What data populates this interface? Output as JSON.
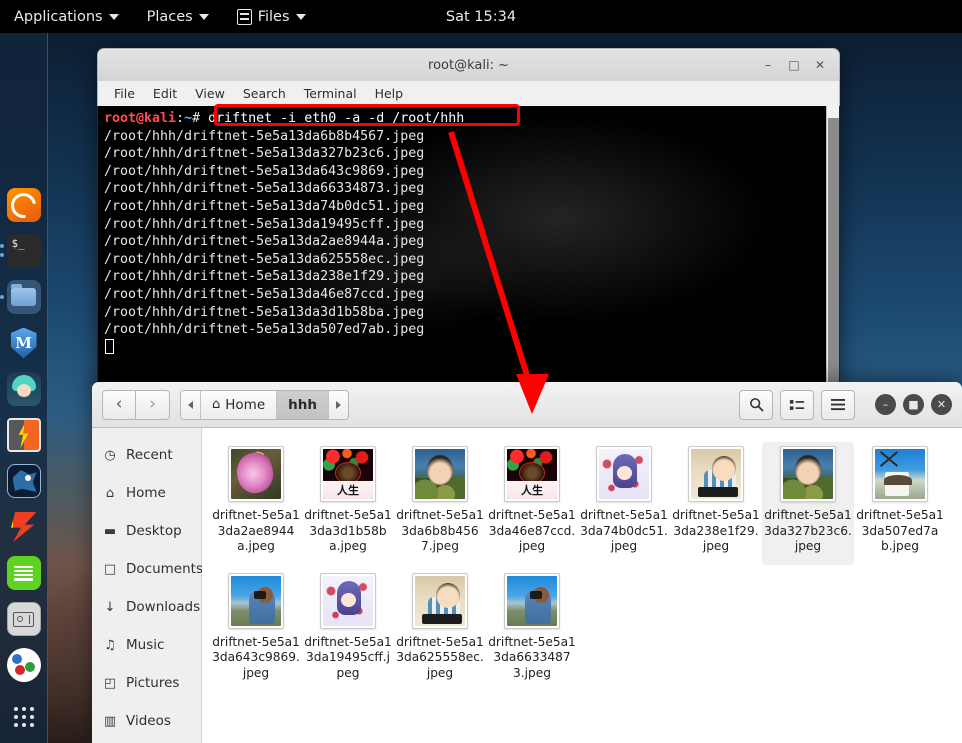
{
  "panel": {
    "applications": "Applications",
    "places": "Places",
    "files": "Files",
    "clock": "Sat 15:34"
  },
  "dock": {
    "items": [
      {
        "name": "firefox-icon",
        "label": "Firefox"
      },
      {
        "name": "terminal-icon",
        "label": "Terminal",
        "glyph": "$_"
      },
      {
        "name": "files-icon",
        "label": "Files"
      },
      {
        "name": "metasploit-icon",
        "label": "Metasploit",
        "glyph": "M"
      },
      {
        "name": "avatar-icon",
        "label": "Avatar"
      },
      {
        "name": "burpsuite-icon",
        "label": "Burp Suite"
      },
      {
        "name": "dragon-icon",
        "label": "Dragon"
      },
      {
        "name": "flame-icon",
        "label": "Flame"
      },
      {
        "name": "notes-icon",
        "label": "Notes"
      },
      {
        "name": "settings-icon",
        "label": "Settings"
      },
      {
        "name": "palette-icon",
        "label": "Palette"
      },
      {
        "name": "show-apps-icon",
        "label": "Show Applications"
      }
    ]
  },
  "terminal": {
    "title": "root@kali: ~",
    "menu": [
      "File",
      "Edit",
      "View",
      "Search",
      "Terminal",
      "Help"
    ],
    "prompt": {
      "user_host": "root@kali",
      "separator": ":",
      "path": "~",
      "symbol": "#"
    },
    "command": "driftnet -i eth0 -a -d /root/hhh",
    "output": [
      "/root/hhh/driftnet-5e5a13da6b8b4567.jpeg",
      "/root/hhh/driftnet-5e5a13da327b23c6.jpeg",
      "/root/hhh/driftnet-5e5a13da643c9869.jpeg",
      "/root/hhh/driftnet-5e5a13da66334873.jpeg",
      "/root/hhh/driftnet-5e5a13da74b0dc51.jpeg",
      "/root/hhh/driftnet-5e5a13da19495cff.jpeg",
      "/root/hhh/driftnet-5e5a13da2ae8944a.jpeg",
      "/root/hhh/driftnet-5e5a13da625558ec.jpeg",
      "/root/hhh/driftnet-5e5a13da238e1f29.jpeg",
      "/root/hhh/driftnet-5e5a13da46e87ccd.jpeg",
      "/root/hhh/driftnet-5e5a13da3d1b58ba.jpeg",
      "/root/hhh/driftnet-5e5a13da507ed7ab.jpeg"
    ],
    "window_buttons": {
      "minimize": "–",
      "maximize": "□",
      "close": "✕"
    },
    "highlight_color": "#ff0000"
  },
  "files": {
    "nav": {
      "back": "‹",
      "forward": "›"
    },
    "breadcrumb": [
      {
        "label": "Home",
        "icon": "home-icon",
        "active": false
      },
      {
        "label": "hhh",
        "icon": "",
        "active": true
      }
    ],
    "toolbar": {
      "search": "search-icon",
      "view_list": "view-list-icon",
      "menu": "hamburger-menu-icon"
    },
    "window_buttons": {
      "minimize": "–",
      "maximize": "■",
      "close": "✕"
    },
    "sidebar": [
      {
        "label": "Recent",
        "icon": "◷"
      },
      {
        "label": "Home",
        "icon": "⌂"
      },
      {
        "label": "Desktop",
        "icon": "▬"
      },
      {
        "label": "Documents",
        "icon": "□"
      },
      {
        "label": "Downloads",
        "icon": "↓"
      },
      {
        "label": "Music",
        "icon": "♫"
      },
      {
        "label": "Pictures",
        "icon": "◰"
      },
      {
        "label": "Videos",
        "icon": "▥"
      }
    ],
    "items": [
      {
        "name": "driftnet-5e5a13da2ae8944a.jpeg",
        "art": "art-flower",
        "selected": false
      },
      {
        "name": "driftnet-5e5a13da3d1b58ba.jpeg",
        "art": "art-life",
        "selected": false
      },
      {
        "name": "driftnet-5e5a13da6b8b4567.jpeg",
        "art": "art-portrait",
        "selected": false
      },
      {
        "name": "driftnet-5e5a13da46e87ccd.jpeg",
        "art": "art-life",
        "selected": false
      },
      {
        "name": "driftnet-5e5a13da74b0dc51.jpeg",
        "art": "art-anime",
        "selected": false
      },
      {
        "name": "driftnet-5e5a13da238e1f29.jpeg",
        "art": "art-child",
        "selected": false
      },
      {
        "name": "driftnet-5e5a13da327b23c6.jpeg",
        "art": "art-portrait",
        "selected": true
      },
      {
        "name": "driftnet-5e5a13da507ed7ab.jpeg",
        "art": "art-windmill",
        "selected": false
      },
      {
        "name": "driftnet-5e5a13da643c9869.jpeg",
        "art": "art-photog",
        "selected": false
      },
      {
        "name": "driftnet-5e5a13da19495cff.jpeg",
        "art": "art-anime",
        "selected": false
      },
      {
        "name": "driftnet-5e5a13da625558ec.jpeg",
        "art": "art-child",
        "selected": false
      },
      {
        "name": "driftnet-5e5a13da66334873.jpeg",
        "art": "art-photog",
        "selected": false
      }
    ],
    "life_text": "人生"
  }
}
